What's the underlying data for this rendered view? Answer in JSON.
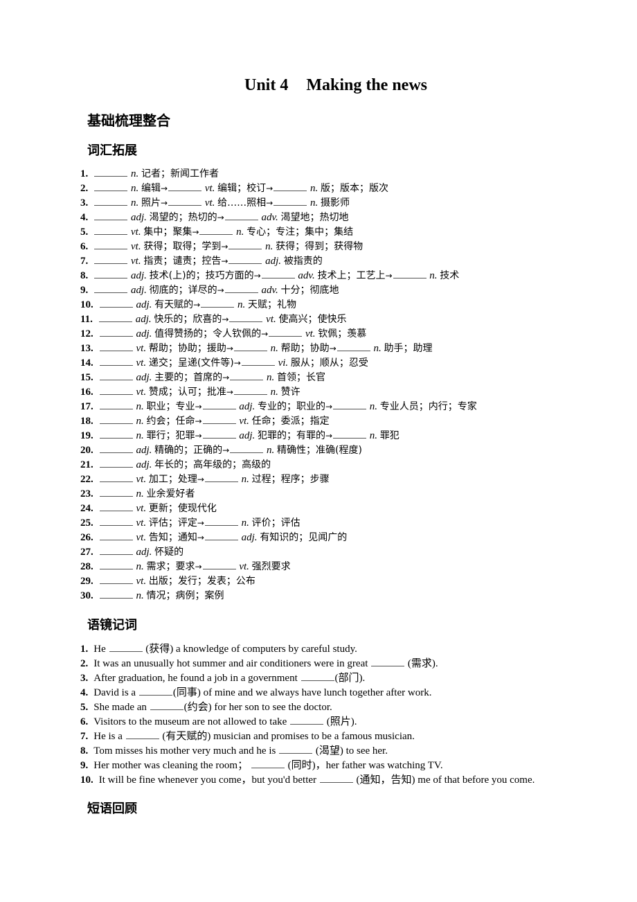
{
  "title": {
    "unit": "Unit 4",
    "name": "Making the news"
  },
  "section_main": "基础梳理整合",
  "sections": {
    "vocab": "词汇拓展",
    "context": "语镜记词",
    "phrases": "短语回顾"
  },
  "vocab_items": [
    {
      "num": "1.",
      "parts": [
        [
          "b"
        ],
        [
          "p",
          "n."
        ],
        [
          "c",
          "记者；新闻工作者"
        ]
      ]
    },
    {
      "num": "2.",
      "parts": [
        [
          "b"
        ],
        [
          "p",
          "n."
        ],
        [
          "c",
          "编辑"
        ],
        [
          "a"
        ],
        [
          "b"
        ],
        [
          "p",
          "vt."
        ],
        [
          "c",
          "编辑；校订"
        ],
        [
          "a"
        ],
        [
          "b"
        ],
        [
          "p",
          "n."
        ],
        [
          "c",
          "版；版本；版次"
        ]
      ]
    },
    {
      "num": "3.",
      "parts": [
        [
          "b"
        ],
        [
          "p",
          "n."
        ],
        [
          "c",
          "照片"
        ],
        [
          "a"
        ],
        [
          "b"
        ],
        [
          "p",
          "vt."
        ],
        [
          "c",
          "给……照相"
        ],
        [
          "a"
        ],
        [
          "b"
        ],
        [
          "p",
          "n."
        ],
        [
          "c",
          "摄影师"
        ]
      ]
    },
    {
      "num": "4.",
      "parts": [
        [
          "b"
        ],
        [
          "p",
          "adj."
        ],
        [
          "c",
          "渴望的；热切的"
        ],
        [
          "a"
        ],
        [
          "b"
        ],
        [
          "p",
          "adv."
        ],
        [
          "c",
          "渴望地；热切地"
        ]
      ]
    },
    {
      "num": "5.",
      "parts": [
        [
          "b"
        ],
        [
          "p",
          "vt."
        ],
        [
          "c",
          "集中；聚集"
        ],
        [
          "a"
        ],
        [
          "b"
        ],
        [
          "p",
          "n."
        ],
        [
          "c",
          "专心；专注；集中；集结"
        ]
      ]
    },
    {
      "num": "6.",
      "parts": [
        [
          "b"
        ],
        [
          "p",
          "vt."
        ],
        [
          "c",
          "获得；取得；学到"
        ],
        [
          "a"
        ],
        [
          "b"
        ],
        [
          "p",
          "n."
        ],
        [
          "c",
          "获得；得到；获得物"
        ]
      ]
    },
    {
      "num": "7.",
      "parts": [
        [
          "b"
        ],
        [
          "p",
          "vt."
        ],
        [
          "c",
          "指责；谴责；控告"
        ],
        [
          "a"
        ],
        [
          "b"
        ],
        [
          "p",
          "adj."
        ],
        [
          "c",
          "被指责的"
        ]
      ]
    },
    {
      "num": "8.",
      "parts": [
        [
          "b"
        ],
        [
          "p",
          "adj."
        ],
        [
          "c",
          "技术(上)的；技巧方面的"
        ],
        [
          "a"
        ],
        [
          "b"
        ],
        [
          "p",
          "adv."
        ],
        [
          "c",
          "技术上；工艺上"
        ],
        [
          "a"
        ],
        [
          "b"
        ],
        [
          "p",
          "n."
        ],
        [
          "c",
          "技术"
        ]
      ]
    },
    {
      "num": "9.",
      "parts": [
        [
          "b"
        ],
        [
          "p",
          "adj."
        ],
        [
          "c",
          "彻底的；详尽的"
        ],
        [
          "a"
        ],
        [
          "b"
        ],
        [
          "p",
          "adv."
        ],
        [
          "c",
          "十分；彻底地"
        ]
      ]
    },
    {
      "num": "10.",
      "parts": [
        [
          "b"
        ],
        [
          "p",
          "adj."
        ],
        [
          "c",
          "有天赋的"
        ],
        [
          "a"
        ],
        [
          "b"
        ],
        [
          "p",
          "n."
        ],
        [
          "c",
          "天赋；礼物"
        ]
      ]
    },
    {
      "num": "11.",
      "parts": [
        [
          "b"
        ],
        [
          "p",
          "adj."
        ],
        [
          "c",
          "快乐的；欣喜的"
        ],
        [
          "a"
        ],
        [
          "b"
        ],
        [
          "p",
          "vt."
        ],
        [
          "c",
          "使高兴；使快乐"
        ]
      ]
    },
    {
      "num": "12.",
      "parts": [
        [
          "b"
        ],
        [
          "p",
          "adj."
        ],
        [
          "c",
          "值得赞扬的；令人钦佩的"
        ],
        [
          "a"
        ],
        [
          "b"
        ],
        [
          "p",
          "vt."
        ],
        [
          "c",
          "钦佩；羡慕"
        ]
      ]
    },
    {
      "num": "13.",
      "parts": [
        [
          "b"
        ],
        [
          "p",
          "vt."
        ],
        [
          "c",
          "帮助；协助；援助"
        ],
        [
          "a"
        ],
        [
          "b"
        ],
        [
          "p",
          "n."
        ],
        [
          "c",
          "帮助；协助"
        ],
        [
          "a"
        ],
        [
          "b"
        ],
        [
          "p",
          "n."
        ],
        [
          "c",
          "助手；助理"
        ]
      ]
    },
    {
      "num": "14.",
      "parts": [
        [
          "b"
        ],
        [
          "p",
          "vt."
        ],
        [
          "c",
          "递交；呈递(文件等)"
        ],
        [
          "a"
        ],
        [
          "b"
        ],
        [
          "p",
          "vi."
        ],
        [
          "c",
          "服从；顺从；忍受"
        ]
      ]
    },
    {
      "num": "15.",
      "parts": [
        [
          "b"
        ],
        [
          "p",
          "adj."
        ],
        [
          "c",
          "主要的；首席的"
        ],
        [
          "a"
        ],
        [
          "b"
        ],
        [
          "p",
          "n."
        ],
        [
          "c",
          "首领；长官"
        ]
      ]
    },
    {
      "num": "16.",
      "parts": [
        [
          "b"
        ],
        [
          "p",
          "vt."
        ],
        [
          "c",
          "赞成；认可；批准"
        ],
        [
          "a"
        ],
        [
          "b"
        ],
        [
          "p",
          "n."
        ],
        [
          "c",
          "赞许"
        ]
      ]
    },
    {
      "num": "17.",
      "parts": [
        [
          "b"
        ],
        [
          "p",
          "n."
        ],
        [
          "c",
          "职业；专业"
        ],
        [
          "a"
        ],
        [
          "b"
        ],
        [
          "p",
          "adj."
        ],
        [
          "c",
          "专业的；职业的"
        ],
        [
          "a"
        ],
        [
          "b"
        ],
        [
          "p",
          "n."
        ],
        [
          "c",
          "专业人员；内行；专家"
        ]
      ]
    },
    {
      "num": "18.",
      "parts": [
        [
          "b"
        ],
        [
          "p",
          "n."
        ],
        [
          "c",
          "约会；任命"
        ],
        [
          "a"
        ],
        [
          "b"
        ],
        [
          "p",
          "vt."
        ],
        [
          "c",
          "任命；委派；指定"
        ]
      ]
    },
    {
      "num": "19.",
      "parts": [
        [
          "b"
        ],
        [
          "p",
          "n."
        ],
        [
          "c",
          "罪行；犯罪"
        ],
        [
          "a"
        ],
        [
          "b"
        ],
        [
          "p",
          "adj."
        ],
        [
          "c",
          "犯罪的；有罪的"
        ],
        [
          "a"
        ],
        [
          "b"
        ],
        [
          "p",
          "n."
        ],
        [
          "c",
          "罪犯"
        ]
      ]
    },
    {
      "num": "20.",
      "parts": [
        [
          "b"
        ],
        [
          "p",
          "adj."
        ],
        [
          "c",
          "精确的；正确的"
        ],
        [
          "a"
        ],
        [
          "b"
        ],
        [
          "p",
          "n."
        ],
        [
          "c",
          "精确性；准确(程度)"
        ]
      ]
    },
    {
      "num": "21.",
      "parts": [
        [
          "b"
        ],
        [
          "p",
          "adj."
        ],
        [
          "c",
          "年长的；高年级的；高级的"
        ]
      ]
    },
    {
      "num": "22.",
      "parts": [
        [
          "b"
        ],
        [
          "p",
          "vt."
        ],
        [
          "c",
          "加工；处理"
        ],
        [
          "a"
        ],
        [
          "b"
        ],
        [
          "p",
          "n."
        ],
        [
          "c",
          "过程；程序；步骤"
        ]
      ]
    },
    {
      "num": "23.",
      "parts": [
        [
          "b"
        ],
        [
          "p",
          "n."
        ],
        [
          "c",
          "业余爱好者"
        ]
      ]
    },
    {
      "num": "24.",
      "parts": [
        [
          "b"
        ],
        [
          "p",
          "vt."
        ],
        [
          "c",
          "更新；使现代化"
        ]
      ]
    },
    {
      "num": "25.",
      "parts": [
        [
          "b"
        ],
        [
          "p",
          "vt."
        ],
        [
          "c",
          "评估；评定"
        ],
        [
          "a"
        ],
        [
          "b"
        ],
        [
          "p",
          "n."
        ],
        [
          "c",
          "评价；评估"
        ]
      ]
    },
    {
      "num": "26.",
      "parts": [
        [
          "b"
        ],
        [
          "p",
          "vt."
        ],
        [
          "c",
          "告知；通知"
        ],
        [
          "a"
        ],
        [
          "b"
        ],
        [
          "p",
          "adj."
        ],
        [
          "c",
          "有知识的；见闻广的"
        ]
      ]
    },
    {
      "num": "27.",
      "parts": [
        [
          "b"
        ],
        [
          "p",
          "adj."
        ],
        [
          "c",
          "怀疑的"
        ]
      ]
    },
    {
      "num": "28.",
      "parts": [
        [
          "b"
        ],
        [
          "p",
          "n."
        ],
        [
          "c",
          "需求；要求"
        ],
        [
          "a"
        ],
        [
          "b"
        ],
        [
          "p",
          "vt."
        ],
        [
          "c",
          "强烈要求"
        ]
      ]
    },
    {
      "num": "29.",
      "parts": [
        [
          "b"
        ],
        [
          "p",
          "vt."
        ],
        [
          "c",
          "出版；发行；发表；公布"
        ]
      ]
    },
    {
      "num": "30.",
      "parts": [
        [
          "b"
        ],
        [
          "p",
          "n."
        ],
        [
          "c",
          "情况；病例；案例"
        ]
      ]
    }
  ],
  "context_items": [
    {
      "num": "1.",
      "parts": [
        [
          "t",
          "He "
        ],
        [
          "b"
        ],
        [
          "t",
          " (获得) a knowledge of computers by careful study."
        ]
      ]
    },
    {
      "num": "2.",
      "parts": [
        [
          "t",
          "It was an unusually hot summer and air conditioners were in great "
        ],
        [
          "b"
        ],
        [
          "t",
          " (需求)."
        ]
      ]
    },
    {
      "num": "3.",
      "parts": [
        [
          "t",
          "After graduation, he found a job in a government "
        ],
        [
          "b"
        ],
        [
          "t",
          "(部门)."
        ]
      ]
    },
    {
      "num": "4.",
      "parts": [
        [
          "t",
          "David is a "
        ],
        [
          "b"
        ],
        [
          "t",
          "(同事) of mine and we always have lunch together after work."
        ]
      ]
    },
    {
      "num": "5.",
      "parts": [
        [
          "t",
          "She made an "
        ],
        [
          "b"
        ],
        [
          "t",
          "(约会) for her son to see the doctor."
        ]
      ]
    },
    {
      "num": "6.",
      "parts": [
        [
          "t",
          "Visitors to the museum are not allowed to take "
        ],
        [
          "b"
        ],
        [
          "t",
          " (照片)."
        ]
      ]
    },
    {
      "num": "7.",
      "parts": [
        [
          "t",
          "He is a "
        ],
        [
          "b"
        ],
        [
          "t",
          " (有天赋的) musician and promises to be a famous musician."
        ]
      ]
    },
    {
      "num": "8.",
      "parts": [
        [
          "t",
          "Tom misses his mother very much and he is "
        ],
        [
          "b"
        ],
        [
          "t",
          " (渴望) to see her."
        ]
      ]
    },
    {
      "num": "9.",
      "parts": [
        [
          "t",
          "Her mother was cleaning the room； "
        ],
        [
          "b"
        ],
        [
          "t",
          " (同时)，her father was watching TV."
        ]
      ]
    },
    {
      "num": "10.",
      "parts": [
        [
          "t",
          "It will be fine whenever you come，but you'd better "
        ],
        [
          "b"
        ],
        [
          "t",
          " (通知，告知) me of that before you come."
        ]
      ]
    }
  ]
}
